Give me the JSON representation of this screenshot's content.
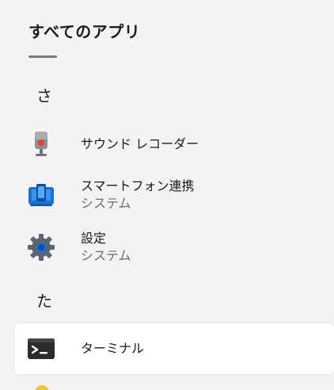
{
  "header": {
    "title": "すべてのアプリ"
  },
  "sections": [
    {
      "letter": "さ",
      "apps": [
        {
          "name": "サウンド レコーダー",
          "subtitle": "",
          "icon": "microphone-icon"
        },
        {
          "name": "スマートフォン連携",
          "subtitle": "システム",
          "icon": "phone-link-icon"
        },
        {
          "name": "設定",
          "subtitle": "システム",
          "icon": "gear-icon"
        }
      ]
    },
    {
      "letter": "た",
      "apps": [
        {
          "name": "ターミナル",
          "subtitle": "",
          "icon": "terminal-icon"
        }
      ]
    }
  ],
  "colors": {
    "background": "#f3f3f3",
    "selected_row": "#ffffff",
    "accent_blue": "#1a6fd0",
    "gear_gray": "#5c6670",
    "recorder_red": "#e2432f",
    "terminal_dark": "#2b2b2b"
  }
}
